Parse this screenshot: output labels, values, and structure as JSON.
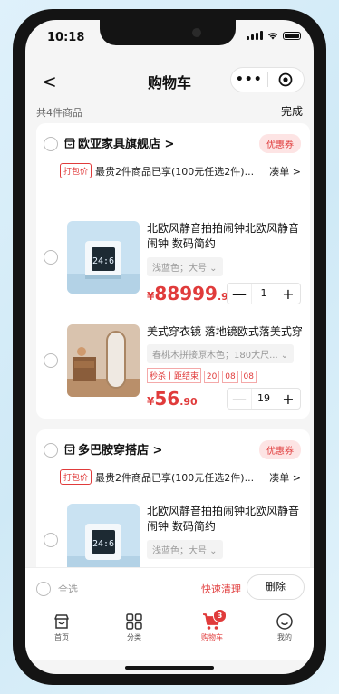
{
  "status_bar": {
    "time": "10:18"
  },
  "nav": {
    "back": "<",
    "title": "购物车",
    "more": "•••"
  },
  "summary": {
    "count": "共4件商品",
    "done": "完成"
  },
  "stores": [
    {
      "name": "欧亚家具旗舰店 >",
      "coupon": "优惠券",
      "promo_tag": "打包价",
      "promo_text": "最贵2件商品已享(100元任选2件)...",
      "collect": "凑单 >",
      "items": [
        {
          "title": "北欧风静音拍拍闹钟北欧风静音闹钟 数码简约",
          "spec": "浅蓝色；大号 ⌄",
          "price_currency": "¥",
          "price_int": "88999",
          "price_dec": ".90",
          "qty": "1",
          "minus": "—",
          "plus": "+"
        },
        {
          "title": "美式穿衣镜 落地镜欧式落美式穿",
          "spec": "春桃木拼接原木色；180大尺... ⌄",
          "flash_label": "秒杀丨距结束",
          "flash_time": [
            "20",
            "08",
            "08"
          ],
          "price_currency": "¥",
          "price_int": "56",
          "price_dec": ".90",
          "qty": "19",
          "minus": "—",
          "plus": "+"
        }
      ]
    },
    {
      "name": "多巴胺穿搭店 >",
      "coupon": "优惠券",
      "promo_tag": "打包价",
      "promo_text": "最贵2件商品已享(100元任选2件)...",
      "collect": "凑单 >",
      "items": [
        {
          "title": "北欧风静音拍拍闹钟北欧风静音闹钟 数码简约",
          "spec": "浅蓝色；大号 ⌄"
        }
      ]
    }
  ],
  "action_bar": {
    "select_all": "全选",
    "quick_clear": "快速清理",
    "delete": "删除"
  },
  "tabs": [
    {
      "label": "首页",
      "icon": "home-icon"
    },
    {
      "label": "分类",
      "icon": "category-icon"
    },
    {
      "label": "购物车",
      "icon": "cart-icon",
      "badge": "3",
      "active": true
    },
    {
      "label": "我的",
      "icon": "profile-icon"
    }
  ],
  "colors": {
    "accent": "#e03b3b",
    "background": "#f5f5f5"
  }
}
